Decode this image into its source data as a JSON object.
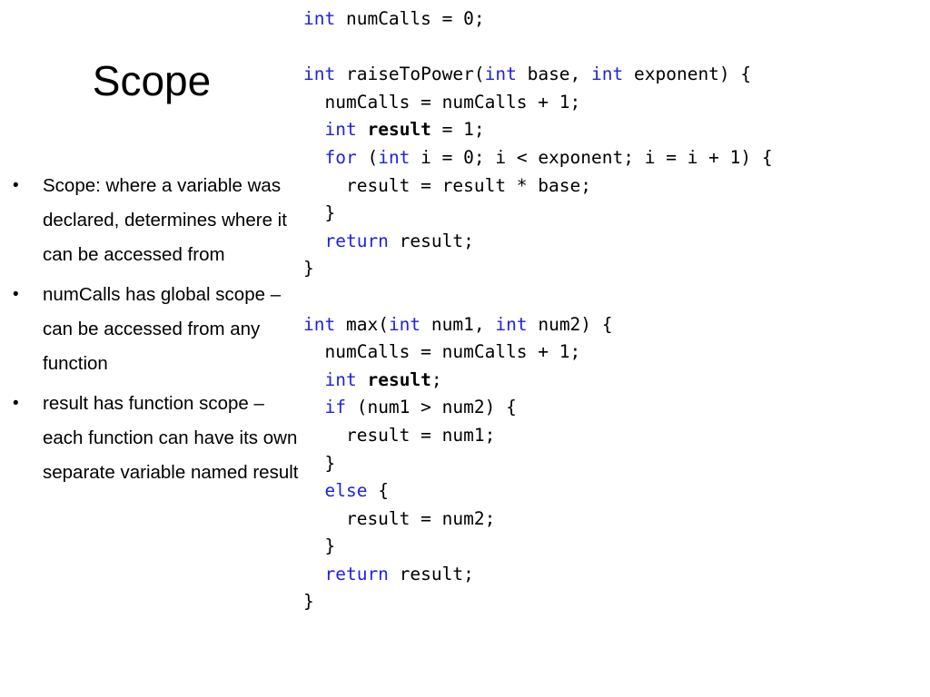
{
  "slide": {
    "title": "Scope",
    "background_color": "#ffffff",
    "text_color": "#000000",
    "keyword_color": "#2222dd"
  },
  "bullets": [
    {
      "marker": "•",
      "text": "Scope: where a variable was declared, determines where it can be accessed from"
    },
    {
      "marker": "•",
      "text": "numCalls has global scope – can be accessed from any function"
    },
    {
      "marker": "•",
      "text": "result has function scope – each function can have its own separate variable named result"
    }
  ],
  "code": {
    "language": "c",
    "lines": [
      [
        {
          "t": "int",
          "s": "kw"
        },
        {
          "t": " numCalls = 0;",
          "s": "plain"
        }
      ],
      [],
      [
        {
          "t": "int",
          "s": "kw"
        },
        {
          "t": " raiseToPower(",
          "s": "plain"
        },
        {
          "t": "int",
          "s": "kw"
        },
        {
          "t": " base, ",
          "s": "plain"
        },
        {
          "t": "int",
          "s": "kw"
        },
        {
          "t": " exponent) {",
          "s": "plain"
        }
      ],
      [
        {
          "t": "  numCalls = numCalls + 1;",
          "s": "plain"
        }
      ],
      [
        {
          "t": "  ",
          "s": "plain"
        },
        {
          "t": "int",
          "s": "kw"
        },
        {
          "t": " ",
          "s": "plain"
        },
        {
          "t": "result",
          "s": "bd"
        },
        {
          "t": " = 1;",
          "s": "plain"
        }
      ],
      [
        {
          "t": "  ",
          "s": "plain"
        },
        {
          "t": "for",
          "s": "kw"
        },
        {
          "t": " (",
          "s": "plain"
        },
        {
          "t": "int",
          "s": "kw"
        },
        {
          "t": " i = 0; i < exponent; i = i + 1) {",
          "s": "plain"
        }
      ],
      [
        {
          "t": "    result = result * base;",
          "s": "plain"
        }
      ],
      [
        {
          "t": "  }",
          "s": "plain"
        }
      ],
      [
        {
          "t": "  ",
          "s": "plain"
        },
        {
          "t": "return",
          "s": "kw"
        },
        {
          "t": " result;",
          "s": "plain"
        }
      ],
      [
        {
          "t": "}",
          "s": "plain"
        }
      ],
      [],
      [
        {
          "t": "int",
          "s": "kw"
        },
        {
          "t": " max(",
          "s": "plain"
        },
        {
          "t": "int",
          "s": "kw"
        },
        {
          "t": " num1, ",
          "s": "plain"
        },
        {
          "t": "int",
          "s": "kw"
        },
        {
          "t": " num2) {",
          "s": "plain"
        }
      ],
      [
        {
          "t": "  numCalls = numCalls + 1;",
          "s": "plain"
        }
      ],
      [
        {
          "t": "  ",
          "s": "plain"
        },
        {
          "t": "int",
          "s": "kw"
        },
        {
          "t": " ",
          "s": "plain"
        },
        {
          "t": "result",
          "s": "bd"
        },
        {
          "t": ";",
          "s": "plain"
        }
      ],
      [
        {
          "t": "  ",
          "s": "plain"
        },
        {
          "t": "if",
          "s": "kw"
        },
        {
          "t": " (num1 > num2) {",
          "s": "plain"
        }
      ],
      [
        {
          "t": "    result = num1;",
          "s": "plain"
        }
      ],
      [
        {
          "t": "  }",
          "s": "plain"
        }
      ],
      [
        {
          "t": "  ",
          "s": "plain"
        },
        {
          "t": "else",
          "s": "kw"
        },
        {
          "t": " {",
          "s": "plain"
        }
      ],
      [
        {
          "t": "    result = num2;",
          "s": "plain"
        }
      ],
      [
        {
          "t": "  }",
          "s": "plain"
        }
      ],
      [
        {
          "t": "  ",
          "s": "plain"
        },
        {
          "t": "return",
          "s": "kw"
        },
        {
          "t": " result;",
          "s": "plain"
        }
      ],
      [
        {
          "t": "}",
          "s": "plain"
        }
      ]
    ]
  }
}
